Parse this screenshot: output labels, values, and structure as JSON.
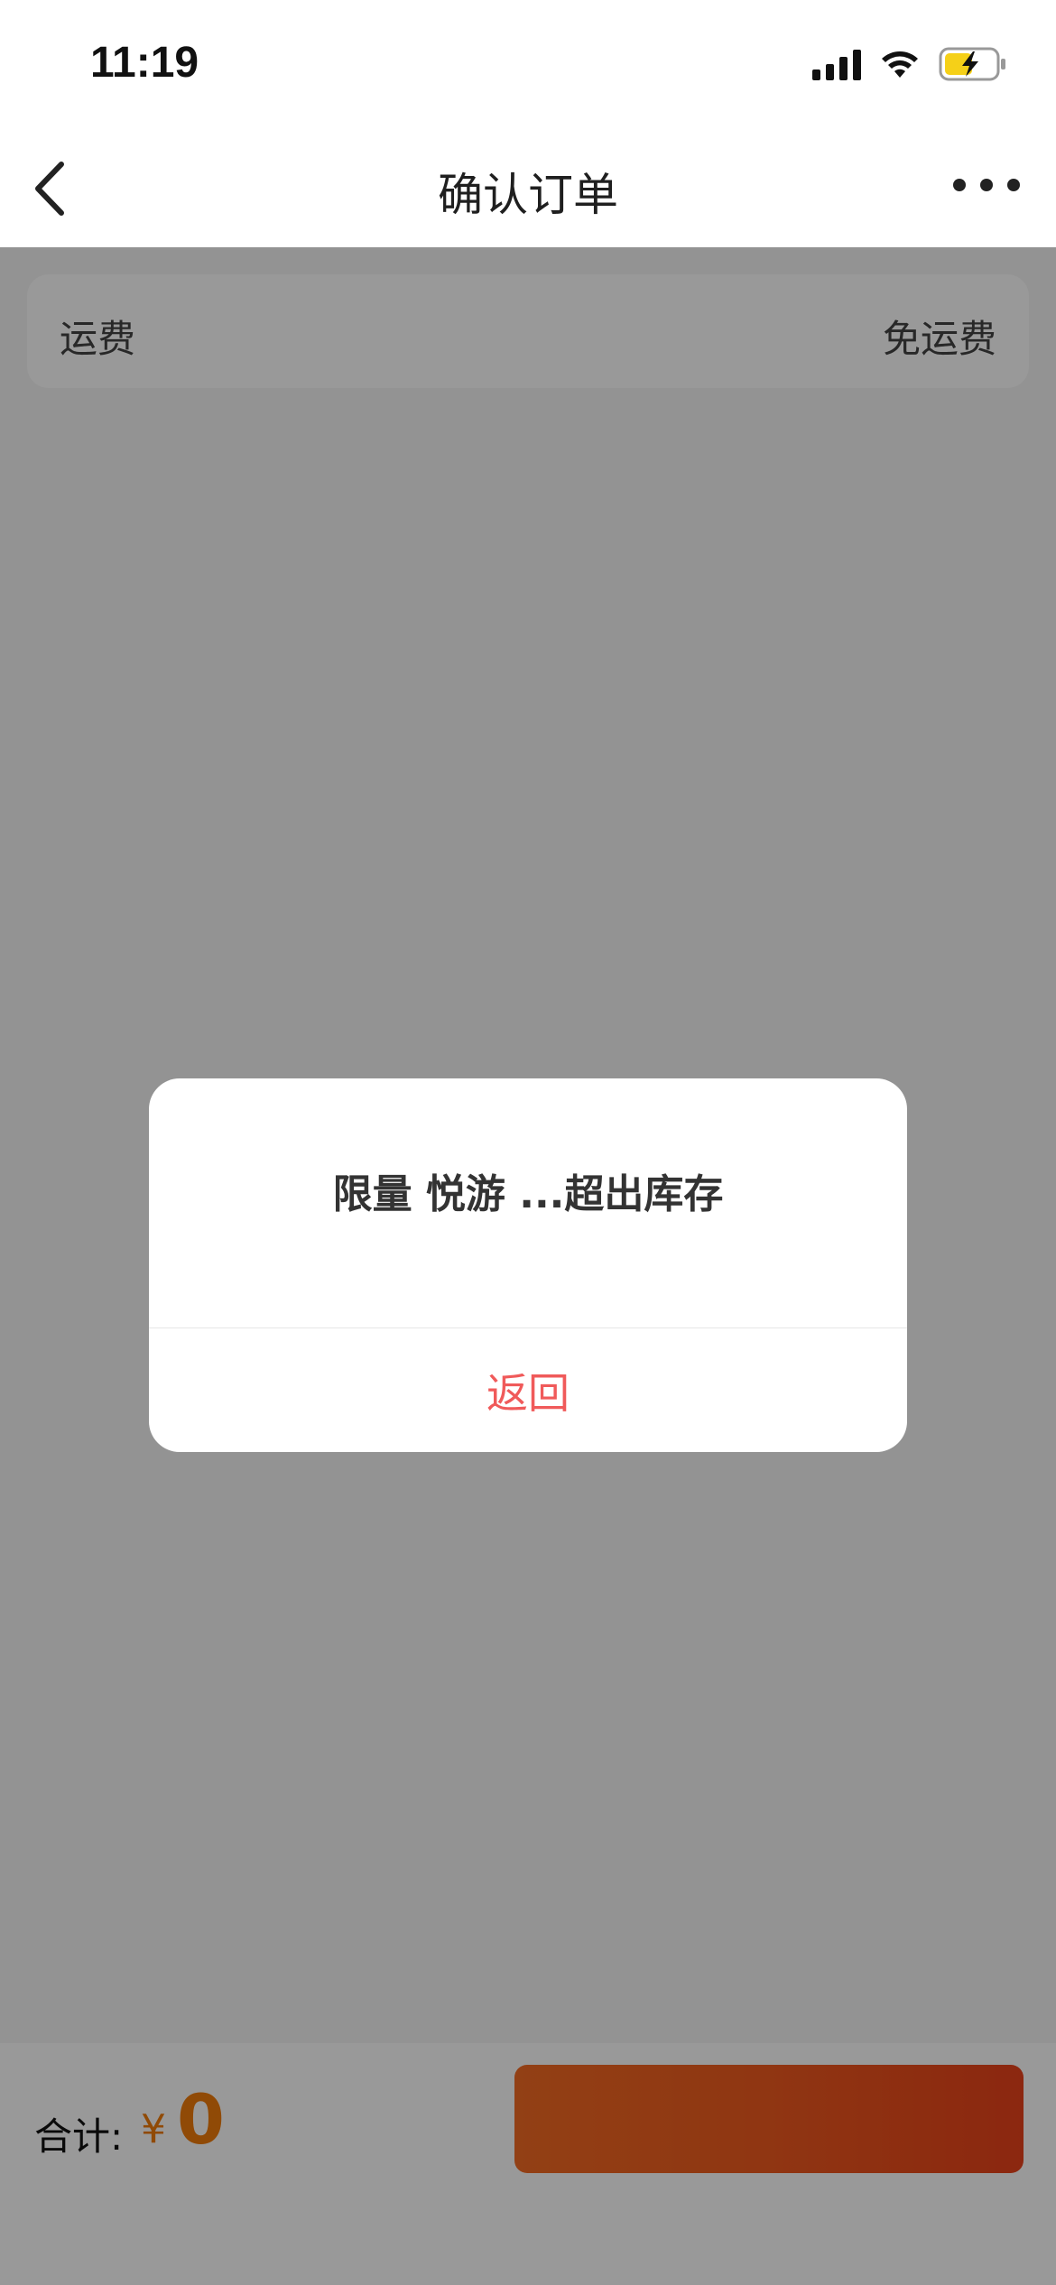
{
  "status_bar": {
    "time": "11:19"
  },
  "nav": {
    "title": "确认订单"
  },
  "shipping": {
    "label": "运费",
    "value": "免运费"
  },
  "bottom": {
    "total_label": "合计:",
    "currency": "¥",
    "amount": "0",
    "submit_label": ""
  },
  "dialog": {
    "message": "限量 悦游 ...超出库存",
    "return_label": "返回"
  },
  "colors": {
    "accent": "#f07c0a",
    "danger": "#f05a5a",
    "button_start": "#f46b23",
    "button_end": "#e9421b",
    "battery_fill": "#f5d018"
  }
}
